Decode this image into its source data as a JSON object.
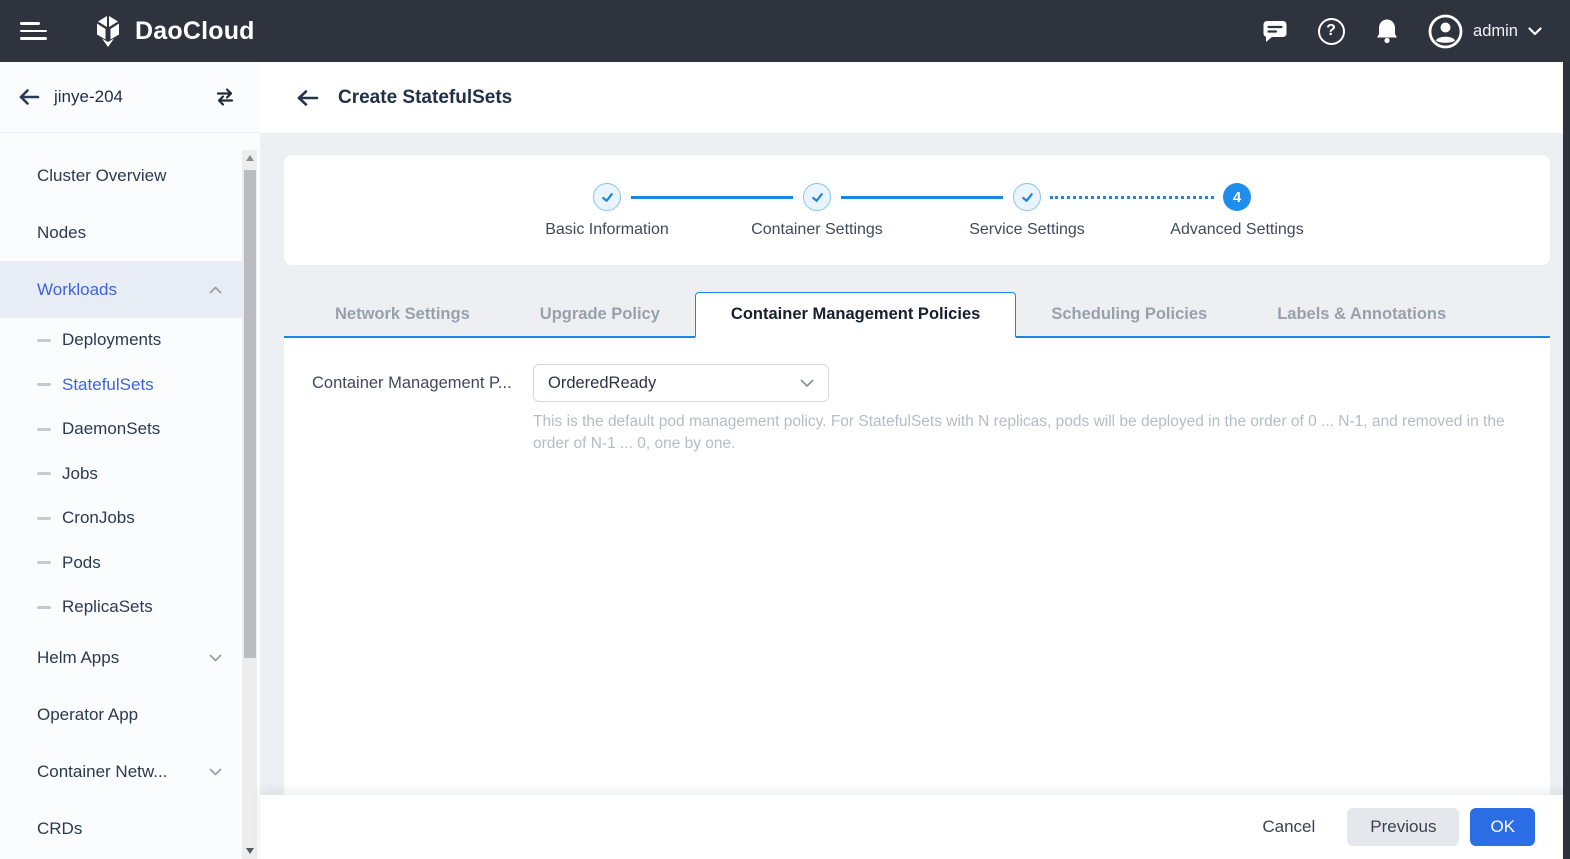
{
  "topbar": {
    "brand": "DaoCloud",
    "username": "admin",
    "help_glyph": "?"
  },
  "sidebar": {
    "cluster_name": "jinye-204",
    "items": [
      {
        "label": "Cluster Overview"
      },
      {
        "label": "Nodes"
      },
      {
        "label": "Workloads"
      },
      {
        "label": "Deployments"
      },
      {
        "label": "StatefulSets"
      },
      {
        "label": "DaemonSets"
      },
      {
        "label": "Jobs"
      },
      {
        "label": "CronJobs"
      },
      {
        "label": "Pods"
      },
      {
        "label": "ReplicaSets"
      },
      {
        "label": "Helm Apps"
      },
      {
        "label": "Operator App"
      },
      {
        "label": "Container Netw..."
      },
      {
        "label": "CRDs"
      }
    ]
  },
  "page": {
    "title": "Create StatefulSets"
  },
  "stepper": {
    "steps": [
      {
        "label": "Basic Information",
        "state": "done"
      },
      {
        "label": "Container Settings",
        "state": "done"
      },
      {
        "label": "Service Settings",
        "state": "done"
      },
      {
        "label": "Advanced Settings",
        "state": "current",
        "number": "4"
      }
    ]
  },
  "tabs": [
    {
      "label": "Network Settings",
      "active": false
    },
    {
      "label": "Upgrade Policy",
      "active": false
    },
    {
      "label": "Container Management Policies",
      "active": true
    },
    {
      "label": "Scheduling Policies",
      "active": false
    },
    {
      "label": "Labels & Annotations",
      "active": false
    }
  ],
  "form": {
    "field_label": "Container Management P...",
    "select_value": "OrderedReady",
    "help_text": "This is the default pod management policy. For StatefulSets with N replicas, pods will be deployed in the order of 0 ... N-1, and removed in the order of N-1 ... 0, one by one."
  },
  "footer": {
    "cancel": "Cancel",
    "previous": "Previous",
    "ok": "OK"
  },
  "colors": {
    "topbar_bg": "#2f333d",
    "accent_blue": "#2b6de4",
    "stepper_blue": "#1b86e3",
    "nav_link_blue": "#3d63de",
    "content_bg": "#edeff3",
    "inactive_tab": "#98a1ab",
    "help_text": "#b6bcc5"
  }
}
